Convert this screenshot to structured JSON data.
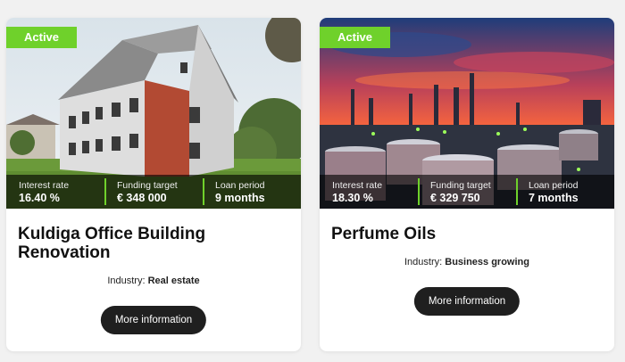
{
  "cards": [
    {
      "status": "Active",
      "stats": [
        {
          "label": "Interest rate",
          "value": "16.40 %"
        },
        {
          "label": "Funding target",
          "value": "€ 348 000"
        },
        {
          "label": "Loan period",
          "value": "9 months"
        }
      ],
      "title": "Kuldiga Office Building Renovation",
      "industry_label": "Industry:",
      "industry_value": "Real estate",
      "button_label": "More information"
    },
    {
      "status": "Active",
      "stats": [
        {
          "label": "Interest rate",
          "value": "18.30 %"
        },
        {
          "label": "Funding target",
          "value": "€ 329 750"
        },
        {
          "label": "Loan period",
          "value": "7 months"
        }
      ],
      "title": "Perfume Oils",
      "industry_label": "Industry:",
      "industry_value": "Business growing",
      "button_label": "More information"
    }
  ],
  "colors": {
    "accent_green": "#6fd12b",
    "button_dark": "#1f1f1f"
  }
}
